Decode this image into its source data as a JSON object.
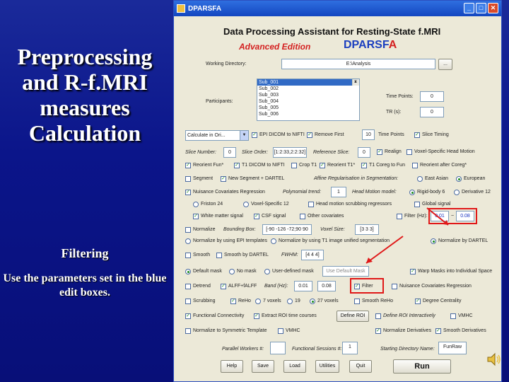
{
  "slide": {
    "title": "Preprocessing and R-f.MRI measures Calculation",
    "filtering": "Filtering",
    "use_params": "Use the parameters set in the blue edit boxes."
  },
  "window": {
    "title": "DPARSFA",
    "heading": "Data Processing Assistant for Resting-State f.MRI",
    "edition": "Advanced Edition",
    "brand_main": "DPARSF",
    "brand_accent": "A",
    "working_dir_label": "Working Directory:",
    "working_dir_value": "E:\\Analysis",
    "browse": "...",
    "participants_label": "Participants:",
    "participants": [
      "Sub_001",
      "Sub_002",
      "Sub_003",
      "Sub_004",
      "Sub_005",
      "Sub_006"
    ],
    "time_points_label": "Time Points:",
    "time_points_value": "0",
    "tr_label": "TR (s):",
    "tr_value": "0",
    "calc_space": "Calculate in Ori...",
    "epi_dicom": "EPI DICOM to NIFTI",
    "remove_first": "Remove First",
    "remove_first_value": "10",
    "time_points2": "Time Points",
    "slice_timing": "Slice Timing",
    "slice_number_label": "Slice Number:",
    "slice_number_value": "0",
    "slice_order_label": "Slice Order:",
    "slice_order_value": "[1:2:33,2:2:32]",
    "ref_slice_label": "Reference Slice:",
    "ref_slice_value": "0",
    "realign": "Realign",
    "voxel_head": "Voxel-Specific Head Motion",
    "reorient_fun": "Reorient Fun*",
    "t1_dicom": "T1 DICOM to NIFTI",
    "crop_t1": "Crop T1",
    "reorient_t1": "Reorient T1*",
    "t1_coreg": "T1 Coreg to Fun",
    "reorient_after": "Reorient after Coreg*",
    "segment": "Segment",
    "new_segment": "New Segment + DARTEL",
    "affine_label": "Affine Regularisation in Segmentation:",
    "east_asian": "East Asian",
    "european": "European",
    "nuisance": "Nuisance Covariates Regression",
    "polynomial_label": "Polynomial trend:",
    "polynomial_value": "1",
    "head_motion_label": "Head Motion model:",
    "rigid6": "Rigid-body 6",
    "deriv12": "Derivative 12",
    "friston24": "Friston 24",
    "voxel12": "Voxel-Specific 12",
    "head_scrub": "Head motion scrubbing regressors",
    "global_signal": "Global signal",
    "wm_signal": "White matter signal",
    "csf_signal": "CSF signal",
    "other_cov": "Other covariates",
    "filter_hz": "Filter (Hz):",
    "filter_low": "0.01",
    "filter_high": "0.08",
    "filter_tilde": "~",
    "normalize": "Normalize",
    "bounding_label": "Bounding Box:",
    "bounding_value": "[-90 -126 -72;90 90 108]",
    "voxel_size_label": "Voxel Size:",
    "voxel_size_value": "[3 3 3]",
    "norm_epi": "Normalize by using EPI templates",
    "norm_t1": "Normalize by using T1 image unified segmentation",
    "norm_dartel": "Normalize by DARTEL",
    "smooth": "Smooth",
    "smooth_dartel": "Smooth by DARTEL",
    "fwhm_label": "FWHM:",
    "fwhm_value": "[4 4 4]",
    "default_mask": "Default mask",
    "no_mask": "No mask",
    "user_mask": "User-defined mask",
    "use_default_mask": "Use Default Mask",
    "warp_masks": "Warp Masks into Individual Space",
    "detrend": "Detrend",
    "alff": "ALFF+fALFF",
    "band_label": "Band (Hz):",
    "band_low": "0.01",
    "band_high": "0.08",
    "filter": "Filter",
    "nuisance_reg": "Nuisance Covariates Regression",
    "scrubbing": "Scrubbing",
    "reho": "ReHo",
    "v7": "7 voxels",
    "v19": "19",
    "v27": "27 voxels",
    "smooth_reho": "Smooth ReHo",
    "degree_centrality": "Degree Centrality",
    "functional_conn": "Functional Connectivity",
    "extract_roi": "Extract ROI time courses",
    "define_roi": "Define ROI",
    "define_roi_inter": "Define ROI Interactively",
    "vmhc_top": "VMHC",
    "normalize_sym": "Normalize to Symmetric Template",
    "vmhc": "VMHC",
    "normalize_deriv": "Normalize Derivatives",
    "smooth_deriv": "Smooth Derivatives",
    "parallel_label": "Parallel Workers #:",
    "parallel_value": "",
    "functional_sessions_label": "Functional Sessions #:",
    "functional_sessions_value": "1",
    "starting_dir_label": "Starting Directory Name:",
    "starting_dir_value": "FunRaw",
    "help": "Help",
    "save": "Save",
    "load": "Load",
    "utilities": "Utilities",
    "quit": "Quit",
    "run": "Run"
  }
}
